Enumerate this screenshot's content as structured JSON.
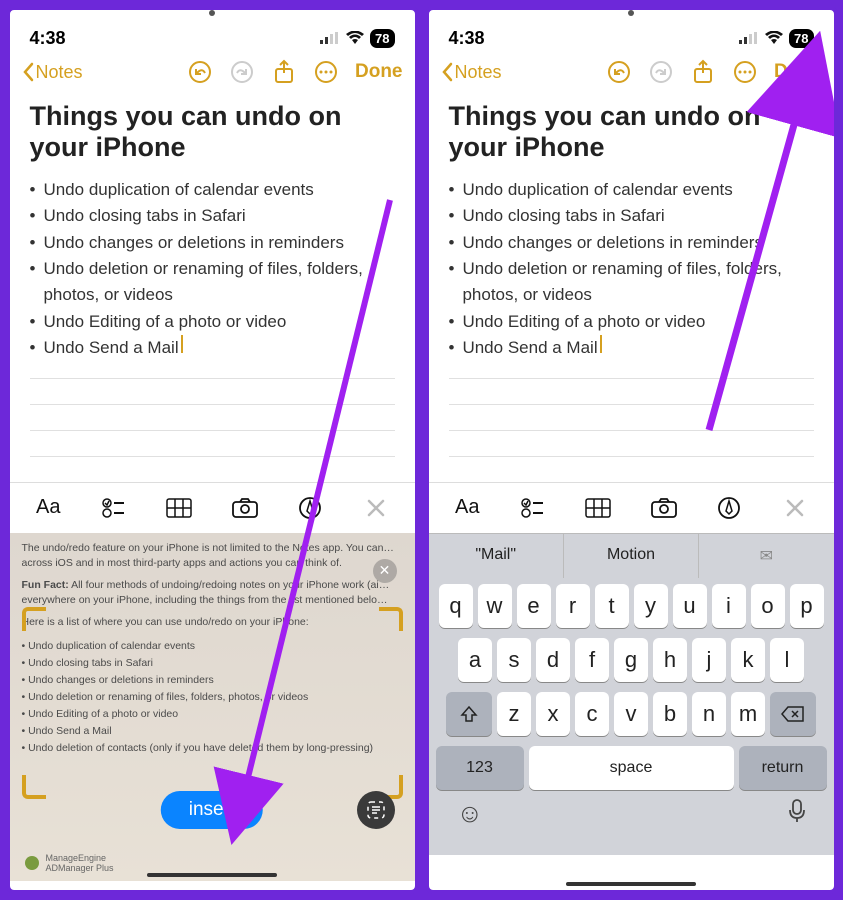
{
  "status": {
    "time": "4:38",
    "battery": "78"
  },
  "nav": {
    "back_label": "Notes",
    "done_label": "Done"
  },
  "note": {
    "title": "Things you can undo on your iPhone",
    "items": [
      "Undo duplication of calendar events",
      "Undo closing tabs in Safari",
      "Undo changes or deletions in reminders",
      "Undo deletion or renaming of files, folders, photos, or videos",
      "Undo Editing of a photo or video",
      "Undo Send a Mail"
    ]
  },
  "livetext": {
    "line1": "The undo/redo feature on your iPhone is not limited to the Notes app. You can…",
    "line2": "across iOS and in most third-party apps and actions you can think of.",
    "funfact_label": "Fun Fact:",
    "funfact": " All four methods of undoing/redoing notes on your iPhone work (ai…",
    "funfact2": "everywhere on your iPhone, including the things from the list mentioned belo…",
    "listhead": "Here is a list of where you can use undo/redo on your iPhone:",
    "items": [
      "Undo duplication of calendar events",
      "Undo closing tabs in Safari",
      "Undo changes or deletions in reminders",
      "Undo deletion or renaming of files, folders, photos, or videos",
      "Undo Editing of a photo or video",
      "Undo Send a Mail",
      "Undo deletion of contacts (only if you have deleted them by long-pressing)"
    ],
    "insert_label": "insert",
    "ad_brand": "ManageEngine",
    "ad_product": "ADManager Plus"
  },
  "suggestions": {
    "s1": "\"Mail\"",
    "s2": "Motion",
    "s3": "✉"
  },
  "keyboard": {
    "row1": [
      "q",
      "w",
      "e",
      "r",
      "t",
      "y",
      "u",
      "i",
      "o",
      "p"
    ],
    "row2": [
      "a",
      "s",
      "d",
      "f",
      "g",
      "h",
      "j",
      "k",
      "l"
    ],
    "row3": [
      "z",
      "x",
      "c",
      "v",
      "b",
      "n",
      "m"
    ],
    "num": "123",
    "space": "space",
    "return": "return"
  },
  "format": {
    "aa": "Aa"
  }
}
